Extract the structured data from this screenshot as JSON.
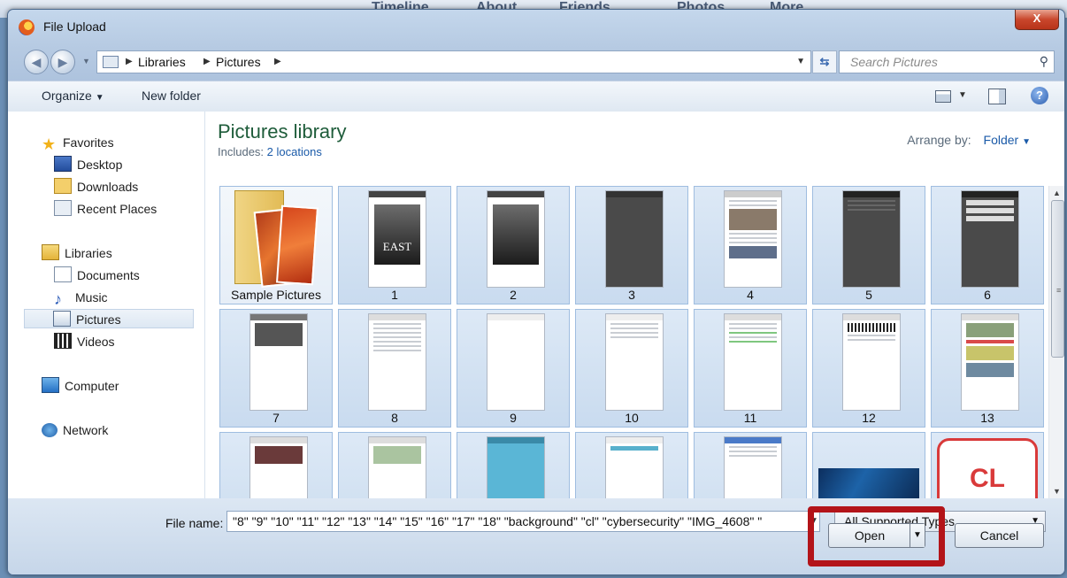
{
  "background": {
    "nav": [
      "Timeline",
      "About",
      "Friends",
      "Photos",
      "More"
    ]
  },
  "window": {
    "title": "File Upload",
    "close_glyph": "X"
  },
  "address": {
    "crumbs": [
      "Libraries",
      "Pictures"
    ],
    "search_placeholder": "Search Pictures"
  },
  "toolbar": {
    "organize": "Organize",
    "new_folder": "New folder",
    "help": "?"
  },
  "nav": {
    "favorites": {
      "title": "Favorites",
      "items": [
        "Desktop",
        "Downloads",
        "Recent Places"
      ]
    },
    "libraries": {
      "title": "Libraries",
      "items": [
        "Documents",
        "Music",
        "Pictures",
        "Videos"
      ]
    },
    "computer": "Computer",
    "network": "Network",
    "selected": "Pictures"
  },
  "content": {
    "title": "Pictures library",
    "includes_label": "Includes:",
    "includes_link": "2 locations",
    "arrange_label": "Arrange by:",
    "arrange_value": "Folder",
    "files": [
      "Sample Pictures",
      "1",
      "2",
      "3",
      "4",
      "5",
      "6",
      "7",
      "8",
      "9",
      "10",
      "11",
      "12",
      "13"
    ],
    "book_word": "EAST",
    "cl_logo": "CL"
  },
  "footer": {
    "file_name_label": "File name:",
    "file_name_value": "\"8\" \"9\" \"10\" \"11\" \"12\" \"13\" \"14\" \"15\" \"16\" \"17\" \"18\" \"background\" \"cl\" \"cybersecurity\" \"IMG_4608\" \"",
    "file_type": "All Supported Types",
    "open": "Open",
    "cancel": "Cancel"
  },
  "colors": {
    "highlight": "#b31419",
    "library_title": "#1e5c3a",
    "link": "#1a5aa8"
  }
}
